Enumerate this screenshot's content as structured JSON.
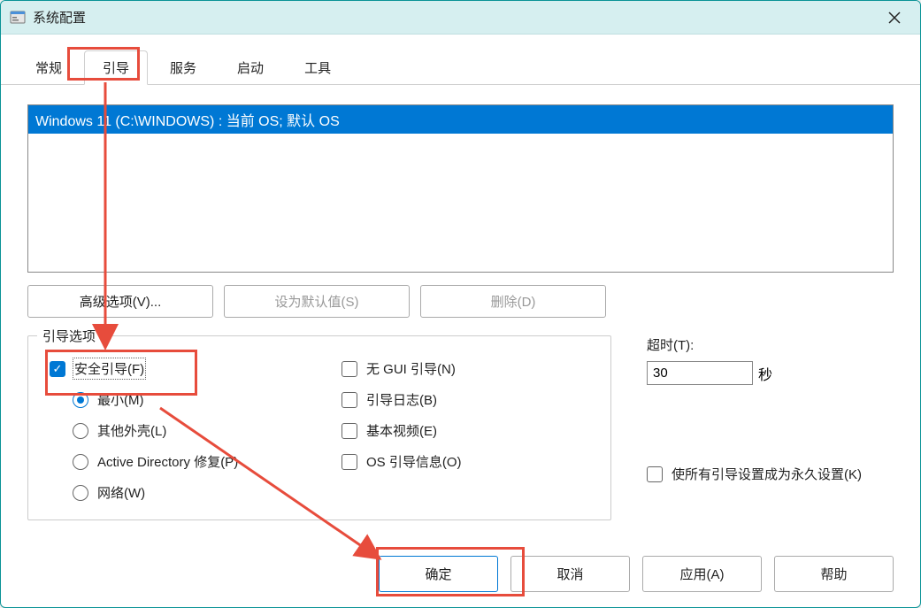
{
  "window": {
    "title": "系统配置",
    "close_aria": "Close"
  },
  "tabs": {
    "items": [
      {
        "label": "常规",
        "active": false
      },
      {
        "label": "引导",
        "active": true
      },
      {
        "label": "服务",
        "active": false
      },
      {
        "label": "启动",
        "active": false
      },
      {
        "label": "工具",
        "active": false
      }
    ]
  },
  "os_list": {
    "items": [
      {
        "text": "Windows 11 (C:\\WINDOWS) : 当前 OS; 默认 OS",
        "selected": true
      }
    ]
  },
  "mid_buttons": {
    "advanced": "高级选项(V)...",
    "set_default": "设为默认值(S)",
    "delete": "删除(D)"
  },
  "boot_options": {
    "legend": "引导选项",
    "safe_boot": {
      "label": "安全引导(F)",
      "checked": true
    },
    "minimal": {
      "label": "最小(M)",
      "checked": true
    },
    "alt_shell": {
      "label": "其他外壳(L)",
      "checked": false
    },
    "ad_repair": {
      "label": "Active Directory 修复(P)",
      "checked": false
    },
    "network": {
      "label": "网络(W)",
      "checked": false
    },
    "no_gui": {
      "label": "无 GUI 引导(N)",
      "checked": false
    },
    "boot_log": {
      "label": "引导日志(B)",
      "checked": false
    },
    "base_video": {
      "label": "基本视频(E)",
      "checked": false
    },
    "os_boot_info": {
      "label": "OS 引导信息(O)",
      "checked": false
    }
  },
  "timeout": {
    "label": "超时(T):",
    "value": "30",
    "unit": "秒"
  },
  "permanent": {
    "label": "使所有引导设置成为永久设置(K)",
    "checked": false
  },
  "bottom": {
    "ok": "确定",
    "cancel": "取消",
    "apply": "应用(A)",
    "help": "帮助"
  }
}
